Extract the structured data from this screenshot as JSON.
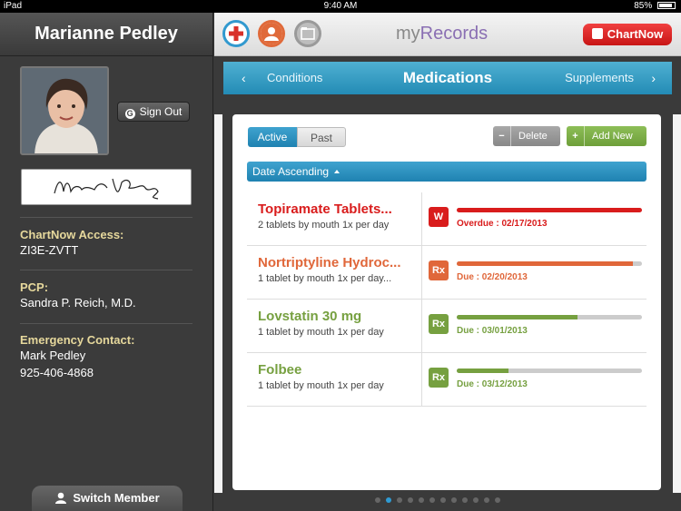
{
  "status": {
    "device": "iPad",
    "time": "9:40 AM",
    "battery": "85%"
  },
  "sidebar": {
    "member_name": "Marianne Pedley",
    "signout_label": "Sign Out",
    "access_label": "ChartNow Access:",
    "access_code": "ZI3E-ZVTT",
    "pcp_label": "PCP:",
    "pcp_name": "Sandra P. Reich, M.D.",
    "emergency_label": "Emergency Contact:",
    "emergency_name": "Mark Pedley",
    "emergency_phone": "925-406-4868",
    "switch_label": "Switch Member"
  },
  "header": {
    "brand_prefix": "my",
    "brand_suffix": "Records",
    "chartnow_label": "ChartNow",
    "icons": [
      "plus-circle-icon",
      "user-circle-icon",
      "folder-icon"
    ]
  },
  "tabs": {
    "prev": "Conditions",
    "current": "Medications",
    "next": "Supplements"
  },
  "filter": {
    "active": "Active",
    "past": "Past"
  },
  "actions": {
    "delete": "Delete",
    "add_new": "Add New"
  },
  "sort": {
    "label": "Date Ascending"
  },
  "medications": [
    {
      "name": "Topiramate Tablets...",
      "dose": "2 tablets by mouth 1x per day",
      "due": "Overdue : 02/17/2013",
      "color": "#d91c1c",
      "badge": "W",
      "progress": 1.0
    },
    {
      "name": "Nortriptyline Hydroc...",
      "dose": "1 tablet by mouth 1x per day...",
      "due": "Due : 02/20/2013",
      "color": "#e0673a",
      "badge": "Rx",
      "progress": 0.95
    },
    {
      "name": "Lovstatin 30 mg",
      "dose": "1 tablet by mouth 1x per day",
      "due": "Due : 03/01/2013",
      "color": "#76a040",
      "badge": "Rx",
      "progress": 0.65
    },
    {
      "name": "Folbee",
      "dose": "1 tablet by mouth 1x per day",
      "due": "Due : 03/12/2013",
      "color": "#76a040",
      "badge": "Rx",
      "progress": 0.28
    }
  ],
  "pager": {
    "count": 12,
    "current": 2
  }
}
